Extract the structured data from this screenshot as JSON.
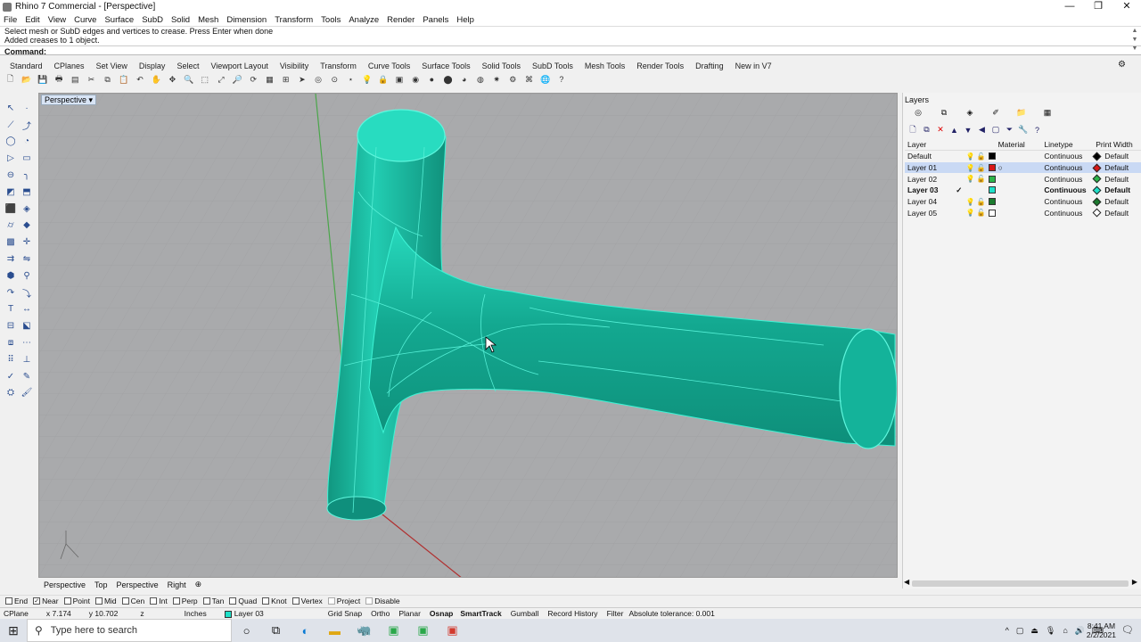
{
  "window": {
    "title": "Rhino 7 Commercial - [Perspective]",
    "controls": [
      "—",
      "❐",
      "✕"
    ]
  },
  "menu": [
    "File",
    "Edit",
    "View",
    "Curve",
    "Surface",
    "SubD",
    "Solid",
    "Mesh",
    "Dimension",
    "Transform",
    "Tools",
    "Analyze",
    "Render",
    "Panels",
    "Help"
  ],
  "command": {
    "history": [
      "Select mesh or SubD edges and vertices to crease. Press Enter when done",
      "Added creases to 1 object."
    ],
    "prompt": "Command:"
  },
  "toolbar_tabs": [
    "Standard",
    "CPlanes",
    "Set View",
    "Display",
    "Select",
    "Viewport Layout",
    "Visibility",
    "Transform",
    "Curve Tools",
    "Surface Tools",
    "Solid Tools",
    "SubD Tools",
    "Mesh Tools",
    "Render Tools",
    "Drafting",
    "New in V7"
  ],
  "viewport": {
    "title": "Perspective",
    "dropdown": "▾",
    "model_color": "#1ecfb5",
    "background": "#a9aaac"
  },
  "view_tabs": [
    "Perspective",
    "Top",
    "Perspective",
    "Right",
    "⊕"
  ],
  "layers_panel": {
    "title": "Layers",
    "columns": {
      "layer": "Layer",
      "material": "Material",
      "linetype": "Linetype",
      "print_width": "Print Width"
    },
    "rows": [
      {
        "name": "Default",
        "linetype": "Continuous",
        "print_width": "Default",
        "color": "#000000",
        "current": "",
        "bulb": "💡",
        "lock": "🔓"
      },
      {
        "name": "Layer 01",
        "linetype": "Continuous",
        "print_width": "Default",
        "color": "#d81818",
        "current": "",
        "bulb": "💡",
        "lock": "🔓"
      },
      {
        "name": "Layer 02",
        "linetype": "Continuous",
        "print_width": "Default",
        "color": "#2db54a",
        "current": "",
        "bulb": "💡",
        "lock": "🔓"
      },
      {
        "name": "Layer 03",
        "linetype": "Continuous",
        "print_width": "Default",
        "color": "#1fe0c8",
        "current": "✓",
        "bulb": "",
        "lock": ""
      },
      {
        "name": "Layer 04",
        "linetype": "Continuous",
        "print_width": "Default",
        "color": "#1b7a2e",
        "current": "",
        "bulb": "💡",
        "lock": "🔓"
      },
      {
        "name": "Layer 05",
        "linetype": "Continuous",
        "print_width": "Default",
        "color": "#ffffff",
        "current": "",
        "bulb": "💡",
        "lock": "🔓"
      }
    ]
  },
  "osnaps": [
    {
      "label": "End",
      "checked": false
    },
    {
      "label": "Near",
      "checked": true
    },
    {
      "label": "Point",
      "checked": false
    },
    {
      "label": "Mid",
      "checked": false
    },
    {
      "label": "Cen",
      "checked": false
    },
    {
      "label": "Int",
      "checked": false
    },
    {
      "label": "Perp",
      "checked": false
    },
    {
      "label": "Tan",
      "checked": false
    },
    {
      "label": "Quad",
      "checked": false
    },
    {
      "label": "Knot",
      "checked": false
    },
    {
      "label": "Vertex",
      "checked": false
    },
    {
      "label": "Project",
      "checked": false
    },
    {
      "label": "Disable",
      "checked": false
    }
  ],
  "status": {
    "cplane": "CPlane",
    "x": "x 7.174",
    "y": "y 10.702",
    "z": "z",
    "units": "Inches",
    "layer": "Layer 03",
    "grid_snap": "Grid Snap",
    "ortho": "Ortho",
    "planar": "Planar",
    "osnap": "Osnap",
    "smarttrack": "SmartTrack",
    "gumball": "Gumball",
    "record_history": "Record History",
    "filter": "Filter",
    "tolerance": "Absolute tolerance: 0.001"
  },
  "taskbar": {
    "search_placeholder": "Type here to search",
    "time": "8:41 AM",
    "date": "2/2/2021"
  }
}
